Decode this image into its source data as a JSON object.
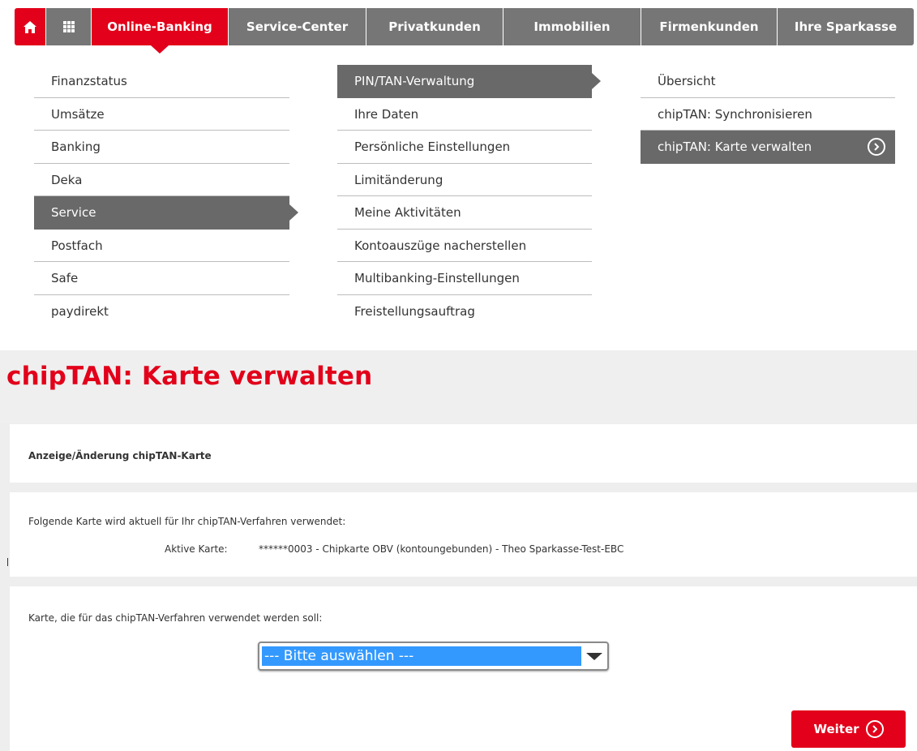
{
  "topnav": {
    "home_icon": "home-icon",
    "apps_icon": "apps-grid-icon",
    "items": [
      {
        "label": "Online-Banking"
      },
      {
        "label": "Service-Center"
      },
      {
        "label": "Privatkunden"
      },
      {
        "label": "Immobilien"
      },
      {
        "label": "Firmenkunden"
      },
      {
        "label": "Ihre Sparkasse"
      }
    ]
  },
  "menu_col1": {
    "items": [
      {
        "label": "Finanzstatus"
      },
      {
        "label": "Umsätze"
      },
      {
        "label": "Banking"
      },
      {
        "label": "Deka"
      },
      {
        "label": "Service"
      },
      {
        "label": "Postfach"
      },
      {
        "label": "Safe"
      },
      {
        "label": "paydirekt"
      }
    ]
  },
  "menu_col2": {
    "items": [
      {
        "label": "PIN/TAN-Verwaltung"
      },
      {
        "label": "Ihre Daten"
      },
      {
        "label": "Persönliche Einstellungen"
      },
      {
        "label": "Limitänderung"
      },
      {
        "label": "Meine Aktivitäten"
      },
      {
        "label": "Kontoauszüge nacherstellen"
      },
      {
        "label": "Multibanking-Einstellungen"
      },
      {
        "label": "Freistellungsauftrag"
      }
    ]
  },
  "menu_col3": {
    "items": [
      {
        "label": "Übersicht"
      },
      {
        "label": "chipTAN: Synchronisieren"
      },
      {
        "label": "chipTAN: Karte verwalten"
      }
    ]
  },
  "page": {
    "title": "chipTAN: Karte verwalten"
  },
  "section1": {
    "heading": "Anzeige/Änderung chipTAN-Karte"
  },
  "section2": {
    "intro": "Folgende Karte wird aktuell für Ihr chipTAN-Verfahren verwendet:",
    "active_label": "Aktive Karte:",
    "active_value": "******0003 - Chipkarte OBV (kontoungebunden) - Theo Sparkasse-Test-EBC"
  },
  "section3": {
    "prompt": "Karte, die für das chipTAN-Verfahren verwendet werden soll:",
    "select_value": "--- Bitte auswählen ---"
  },
  "actions": {
    "next_label": "Weiter"
  },
  "colors": {
    "brand_red": "#e2001a",
    "nav_grey": "#767676",
    "active_grey": "#696969",
    "selection_blue": "#3399ff"
  }
}
